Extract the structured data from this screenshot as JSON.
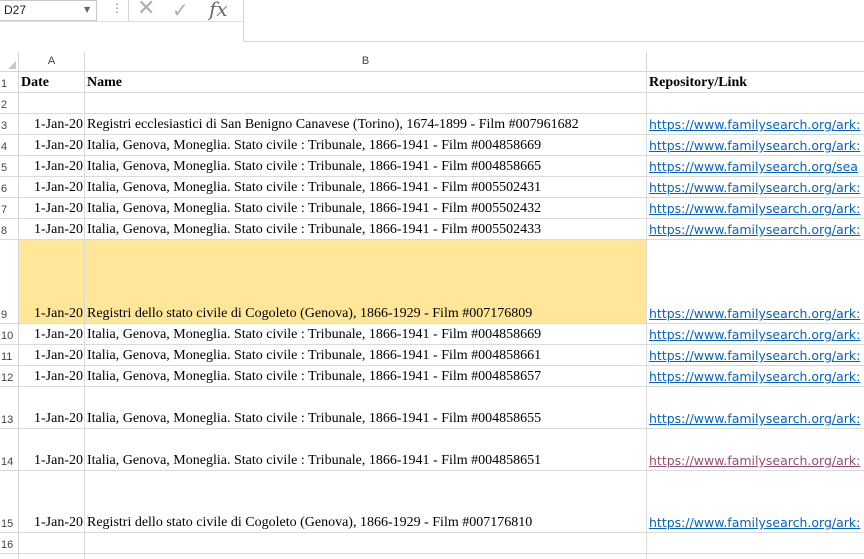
{
  "formula_bar": {
    "name_box": "D27",
    "dots": "⋮",
    "cancel_glyph": "✕",
    "enter_glyph": "✓",
    "fx_glyph": "fx",
    "formula": ""
  },
  "columns": [
    "A",
    "B"
  ],
  "header": {
    "row_num": "1",
    "date": "Date",
    "name": "Name",
    "link": "Repository/Link"
  },
  "rows": [
    {
      "num": "2",
      "date": "",
      "name": "",
      "link": ""
    },
    {
      "num": "3",
      "date": "1-Jan-20",
      "name": "Registri ecclesiastici di San Benigno Canavese (Torino), 1674-1899 - Film #007961682",
      "link": "https://www.familysearch.org/ark:"
    },
    {
      "num": "4",
      "date": "1-Jan-20",
      "name": "Italia, Genova, Moneglia. Stato civile : Tribunale, 1866-1941 - Film #004858669",
      "link": "https://www.familysearch.org/ark:"
    },
    {
      "num": "5",
      "date": "1-Jan-20",
      "name": "Italia, Genova, Moneglia. Stato civile : Tribunale, 1866-1941 - Film #004858665",
      "link": "https://www.familysearch.org/sea"
    },
    {
      "num": "6",
      "date": "1-Jan-20",
      "name": "Italia, Genova, Moneglia. Stato civile : Tribunale, 1866-1941 - Film #005502431",
      "link": "https://www.familysearch.org/ark:"
    },
    {
      "num": "7",
      "date": "1-Jan-20",
      "name": "Italia, Genova, Moneglia. Stato civile : Tribunale, 1866-1941 - Film #005502432",
      "link": "https://www.familysearch.org/ark:"
    },
    {
      "num": "8",
      "date": "1-Jan-20",
      "name": "Italia, Genova, Moneglia. Stato civile : Tribunale, 1866-1941 - Film #005502433",
      "link": "https://www.familysearch.org/ark:"
    },
    {
      "num": "9",
      "date": "1-Jan-20",
      "name": "Registri dello stato civile di Cogoleto (Genova), 1866-1929 - Film #007176809",
      "link": "https://www.familysearch.org/ark:"
    },
    {
      "num": "10",
      "date": "1-Jan-20",
      "name": "Italia, Genova, Moneglia. Stato civile : Tribunale, 1866-1941 - Film #004858669",
      "link": "https://www.familysearch.org/ark:"
    },
    {
      "num": "11",
      "date": "1-Jan-20",
      "name": "Italia, Genova, Moneglia. Stato civile : Tribunale, 1866-1941 - Film #004858661",
      "link": "https://www.familysearch.org/ark:"
    },
    {
      "num": "12",
      "date": "1-Jan-20",
      "name": "Italia, Genova, Moneglia. Stato civile : Tribunale, 1866-1941 - Film #004858657",
      "link": "https://www.familysearch.org/ark:"
    },
    {
      "num": "13",
      "date": "1-Jan-20",
      "name": "Italia, Genova, Moneglia. Stato civile : Tribunale, 1866-1941 - Film #004858655",
      "link": "https://www.familysearch.org/ark:"
    },
    {
      "num": "14",
      "date": "1-Jan-20",
      "name": "Italia, Genova, Moneglia. Stato civile : Tribunale, 1866-1941 - Film #004858651",
      "link": "https://www.familysearch.org/ark:"
    },
    {
      "num": "15",
      "date": "1-Jan-20",
      "name": "Registri dello stato civile di Cogoleto (Genova), 1866-1929 - Film #007176810",
      "link": "https://www.familysearch.org/ark:"
    },
    {
      "num": "16",
      "date": "",
      "name": "",
      "link": ""
    }
  ],
  "colors": {
    "highlight_row": "#ffe699",
    "hyperlink": "#0563c1",
    "visited_link": "#954f72"
  }
}
